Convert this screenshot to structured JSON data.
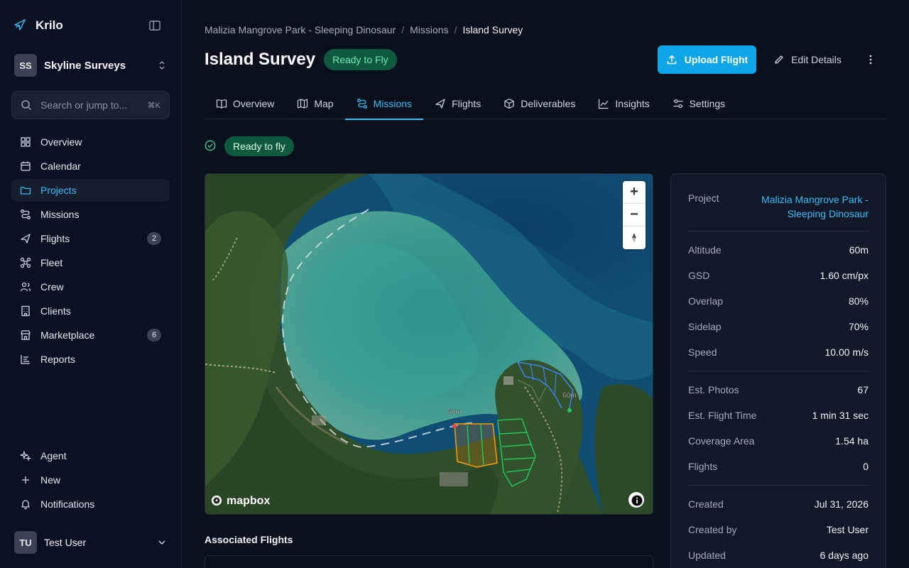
{
  "app": {
    "name": "Krilo"
  },
  "org": {
    "initials": "SS",
    "name": "Skyline Surveys"
  },
  "search": {
    "placeholder": "Search or jump to...",
    "shortcut": "⌘K"
  },
  "nav": {
    "items": [
      {
        "label": "Overview"
      },
      {
        "label": "Calendar"
      },
      {
        "label": "Projects"
      },
      {
        "label": "Missions"
      },
      {
        "label": "Flights",
        "badge": "2"
      },
      {
        "label": "Fleet"
      },
      {
        "label": "Crew"
      },
      {
        "label": "Clients"
      },
      {
        "label": "Marketplace",
        "badge": "6"
      },
      {
        "label": "Reports"
      }
    ],
    "bottom": [
      {
        "label": "Agent"
      },
      {
        "label": "New"
      },
      {
        "label": "Notifications"
      }
    ]
  },
  "user": {
    "initials": "TU",
    "name": "Test User"
  },
  "breadcrumb": {
    "project": "Malizia Mangrove Park - Sleeping Dinosaur",
    "section": "Missions",
    "current": "Island Survey"
  },
  "header": {
    "title": "Island Survey",
    "status": "Ready to Fly",
    "upload_label": "Upload Flight",
    "edit_label": "Edit Details"
  },
  "tabs": [
    {
      "label": "Overview"
    },
    {
      "label": "Map"
    },
    {
      "label": "Missions"
    },
    {
      "label": "Flights"
    },
    {
      "label": "Deliverables"
    },
    {
      "label": "Insights"
    },
    {
      "label": "Settings"
    }
  ],
  "ready": {
    "label": "Ready to fly"
  },
  "map": {
    "label_a": "60m",
    "label_b": "60m",
    "attribution": "mapbox",
    "zoom_in": "+",
    "zoom_out": "−"
  },
  "assoc": {
    "title": "Associated Flights"
  },
  "details": {
    "project_label": "Project",
    "project_line1": "Malizia Mangrove Park -",
    "project_line2": "Sleeping Dinosaur",
    "rows1": [
      {
        "k": "Altitude",
        "v": "60m"
      },
      {
        "k": "GSD",
        "v": "1.60 cm/px"
      },
      {
        "k": "Overlap",
        "v": "80%"
      },
      {
        "k": "Sidelap",
        "v": "70%"
      },
      {
        "k": "Speed",
        "v": "10.00 m/s"
      }
    ],
    "rows2": [
      {
        "k": "Est. Photos",
        "v": "67"
      },
      {
        "k": "Est. Flight Time",
        "v": "1 min 31 sec"
      },
      {
        "k": "Coverage Area",
        "v": "1.54 ha"
      },
      {
        "k": "Flights",
        "v": "0"
      }
    ],
    "rows3": [
      {
        "k": "Created",
        "v": "Jul 31, 2026"
      },
      {
        "k": "Created by",
        "v": "Test User"
      },
      {
        "k": "Updated",
        "v": "6 days ago"
      }
    ]
  },
  "colors": {
    "accent": "#38bdf8",
    "button": "#0ea5e9",
    "status_bg": "#0f5a3f",
    "status_text": "#6ee7b7"
  }
}
